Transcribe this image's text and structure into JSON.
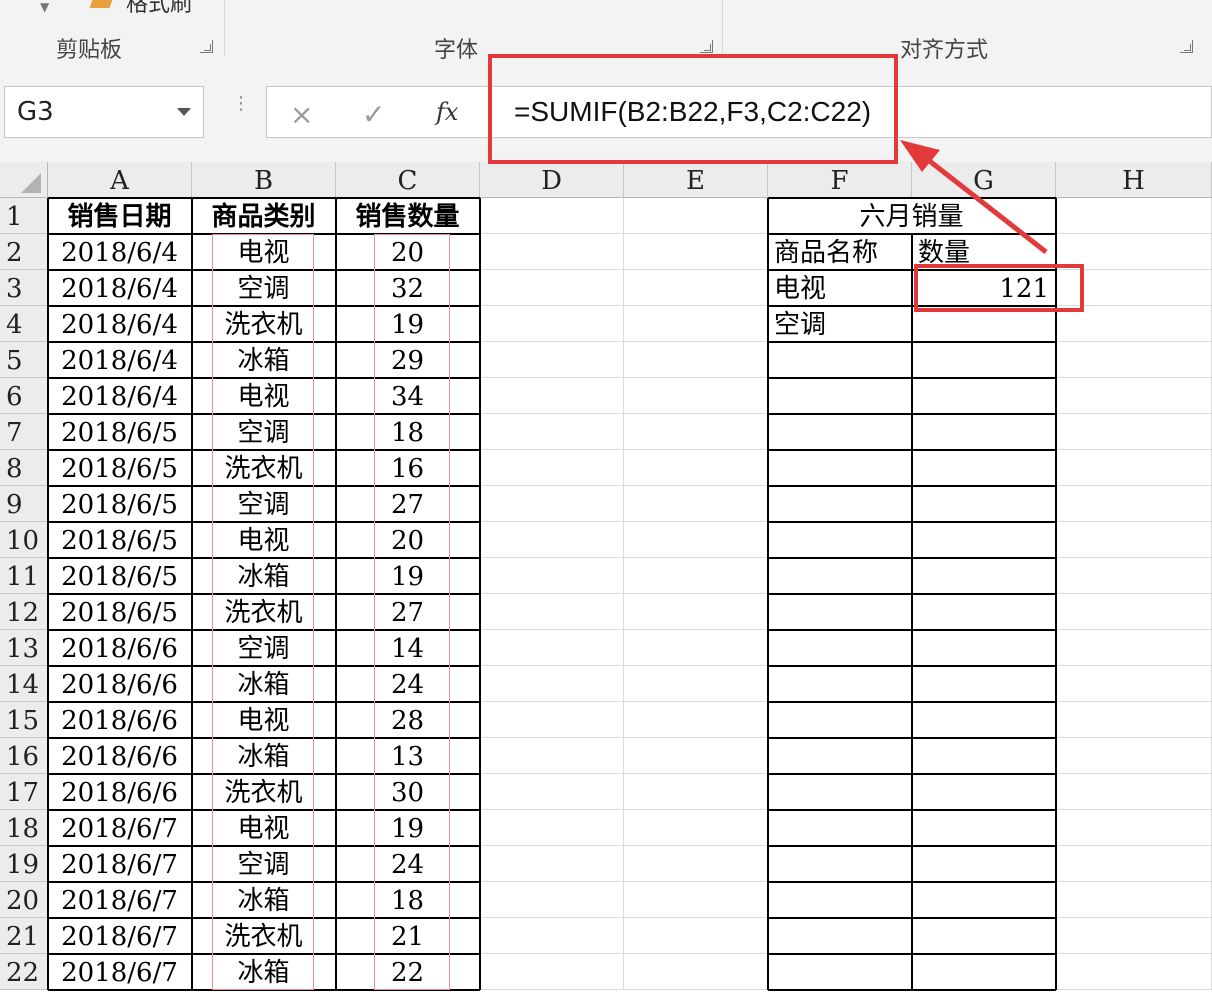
{
  "ribbon": {
    "groups": [
      {
        "label": "剪贴板"
      },
      {
        "label": "字体"
      },
      {
        "label": "对齐方式"
      }
    ],
    "format_painter_label": "格式刷"
  },
  "formula_bar": {
    "name_box": "G3",
    "cancel_icon": "×",
    "enter_icon": "✓",
    "fx_icon": "fx",
    "formula": "=SUMIF(B2:B22,F3,C2:C22)"
  },
  "columns": [
    "A",
    "B",
    "C",
    "D",
    "E",
    "F",
    "G",
    "H"
  ],
  "rows": [
    "1",
    "2",
    "3",
    "4",
    "5",
    "6",
    "7",
    "8",
    "9",
    "10",
    "11",
    "12",
    "13",
    "14",
    "15",
    "16",
    "17",
    "18",
    "19",
    "20",
    "21",
    "22"
  ],
  "sales_table": {
    "headers": [
      "销售日期",
      "商品类别",
      "销售数量"
    ],
    "rows": [
      [
        "2018/6/4",
        "电视",
        "20"
      ],
      [
        "2018/6/4",
        "空调",
        "32"
      ],
      [
        "2018/6/4",
        "洗衣机",
        "19"
      ],
      [
        "2018/6/4",
        "冰箱",
        "29"
      ],
      [
        "2018/6/4",
        "电视",
        "34"
      ],
      [
        "2018/6/5",
        "空调",
        "18"
      ],
      [
        "2018/6/5",
        "洗衣机",
        "16"
      ],
      [
        "2018/6/5",
        "空调",
        "27"
      ],
      [
        "2018/6/5",
        "电视",
        "20"
      ],
      [
        "2018/6/5",
        "冰箱",
        "19"
      ],
      [
        "2018/6/5",
        "洗衣机",
        "27"
      ],
      [
        "2018/6/6",
        "空调",
        "14"
      ],
      [
        "2018/6/6",
        "冰箱",
        "24"
      ],
      [
        "2018/6/6",
        "电视",
        "28"
      ],
      [
        "2018/6/6",
        "冰箱",
        "13"
      ],
      [
        "2018/6/6",
        "洗衣机",
        "30"
      ],
      [
        "2018/6/7",
        "电视",
        "19"
      ],
      [
        "2018/6/7",
        "空调",
        "24"
      ],
      [
        "2018/6/7",
        "冰箱",
        "18"
      ],
      [
        "2018/6/7",
        "洗衣机",
        "21"
      ],
      [
        "2018/6/7",
        "冰箱",
        "22"
      ]
    ]
  },
  "summary_table": {
    "title": "六月销量",
    "headers": [
      "商品名称",
      "数量"
    ],
    "rows": [
      [
        "电视",
        "121"
      ],
      [
        "空调",
        ""
      ]
    ]
  },
  "colors": {
    "highlight": "#e23a3a",
    "header_bg": "#ececec"
  }
}
